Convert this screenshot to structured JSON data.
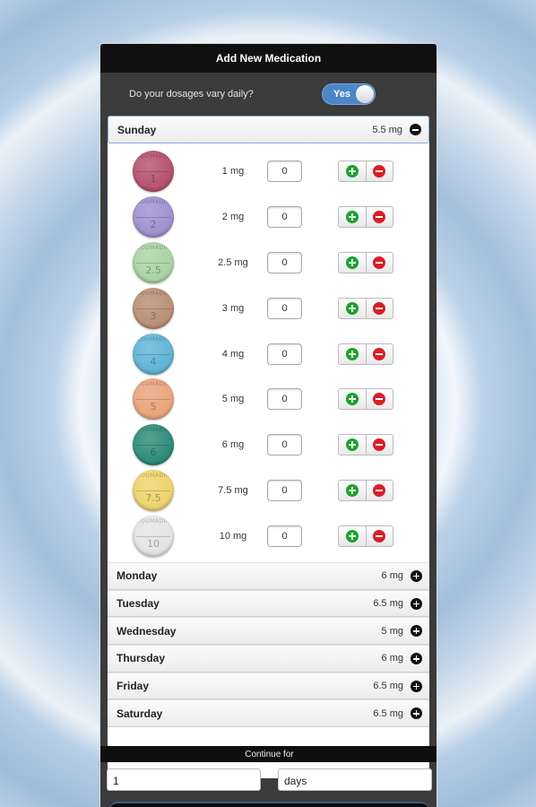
{
  "dialog": {
    "title": "Add New Medication",
    "vary_question": "Do your dosages vary daily?",
    "vary_toggle": {
      "label": "Yes",
      "on": true
    }
  },
  "sunday": {
    "name": "Sunday",
    "total": "5.5 mg",
    "icon": "minus-circle-icon",
    "doses": [
      {
        "brand": "COUMADIN",
        "strength": "1",
        "label": "1 mg",
        "qty": "0",
        "color": "#b54f6d"
      },
      {
        "brand": "COUMADIN",
        "strength": "2",
        "label": "2 mg",
        "qty": "0",
        "color": "#9f8fcf"
      },
      {
        "brand": "COUMADIN",
        "strength": "2.5",
        "label": "2.5 mg",
        "qty": "0",
        "color": "#a9d3a3"
      },
      {
        "brand": "COUMADIN",
        "strength": "3",
        "label": "3 mg",
        "qty": "0",
        "color": "#b88e74"
      },
      {
        "brand": "COUMADIN",
        "strength": "4",
        "label": "4 mg",
        "qty": "0",
        "color": "#5fb3d6"
      },
      {
        "brand": "COUMADIN",
        "strength": "5",
        "label": "5 mg",
        "qty": "0",
        "color": "#e9a37b"
      },
      {
        "brand": "COUMADIN",
        "strength": "6",
        "label": "6 mg",
        "qty": "0",
        "color": "#2c8a78"
      },
      {
        "brand": "COUMADIN",
        "strength": "7.5",
        "label": "7.5 mg",
        "qty": "0",
        "color": "#eed36a"
      },
      {
        "brand": "COUMADIN",
        "strength": "10",
        "label": "10 mg",
        "qty": "0",
        "color": "#e4e4e4"
      }
    ]
  },
  "other_days": [
    {
      "name": "Monday",
      "total": "6 mg",
      "icon": "plus-circle-icon"
    },
    {
      "name": "Tuesday",
      "total": "6.5 mg",
      "icon": "plus-circle-icon"
    },
    {
      "name": "Wednesday",
      "total": "5 mg",
      "icon": "plus-circle-icon"
    },
    {
      "name": "Thursday",
      "total": "6 mg",
      "icon": "plus-circle-icon"
    },
    {
      "name": "Friday",
      "total": "6.5 mg",
      "icon": "plus-circle-icon"
    },
    {
      "name": "Saturday",
      "total": "6.5 mg",
      "icon": "plus-circle-icon"
    }
  ],
  "continue": {
    "label": "Continue for",
    "count": "1",
    "unit": "days"
  },
  "colors": {
    "toggle_on": "#4b87c8",
    "add": "#1aa32a",
    "remove": "#d91f26"
  }
}
